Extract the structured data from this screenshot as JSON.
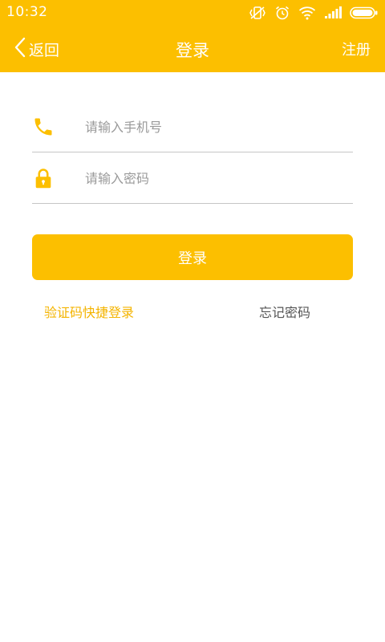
{
  "status_bar": {
    "time": "10:32",
    "icons": [
      "vibrate-off-icon",
      "alarm-icon",
      "wifi-icon",
      "signal-icon",
      "battery-icon"
    ]
  },
  "nav": {
    "back_label": "返回",
    "title": "登录",
    "register_label": "注册"
  },
  "form": {
    "phone_placeholder": "请输入手机号",
    "phone_value": "",
    "password_placeholder": "请输入密码",
    "password_value": ""
  },
  "actions": {
    "login_label": "登录",
    "sms_login_label": "验证码快捷登录",
    "forgot_password_label": "忘记密码"
  },
  "colors": {
    "brand": "#FCBF00",
    "link_accent": "#F4B400",
    "secondary_text": "#555555",
    "placeholder": "#9A9A9A",
    "divider": "#C6C6C6"
  }
}
